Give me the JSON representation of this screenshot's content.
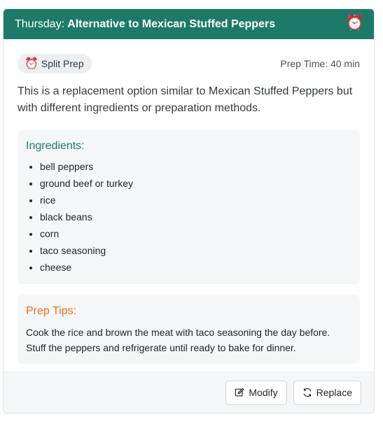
{
  "header": {
    "day": "Thursday:",
    "title": "Alternative to Mexican Stuffed Peppers",
    "icon": "alarm-clock-icon"
  },
  "badge": {
    "icon": "alarm-clock-icon",
    "label": "Split Prep"
  },
  "prep_time": "Prep Time: 40 min",
  "description": "This is a replacement option similar to Mexican Stuffed Peppers but with different ingredients or preparation methods.",
  "ingredients": {
    "title": "Ingredients:",
    "items": [
      "bell peppers",
      "ground beef or turkey",
      "rice",
      "black beans",
      "corn",
      "taco seasoning",
      "cheese"
    ]
  },
  "tips": {
    "title": "Prep Tips:",
    "text": "Cook the rice and brown the meat with taco seasoning the day before. Stuff the peppers and refrigerate until ready to bake for dinner."
  },
  "footer": {
    "modify_label": "Modify",
    "replace_label": "Replace"
  },
  "colors": {
    "header_bg": "#1e7a68",
    "ingredients_title": "#1e7a68",
    "tips_title": "#e8711a"
  }
}
